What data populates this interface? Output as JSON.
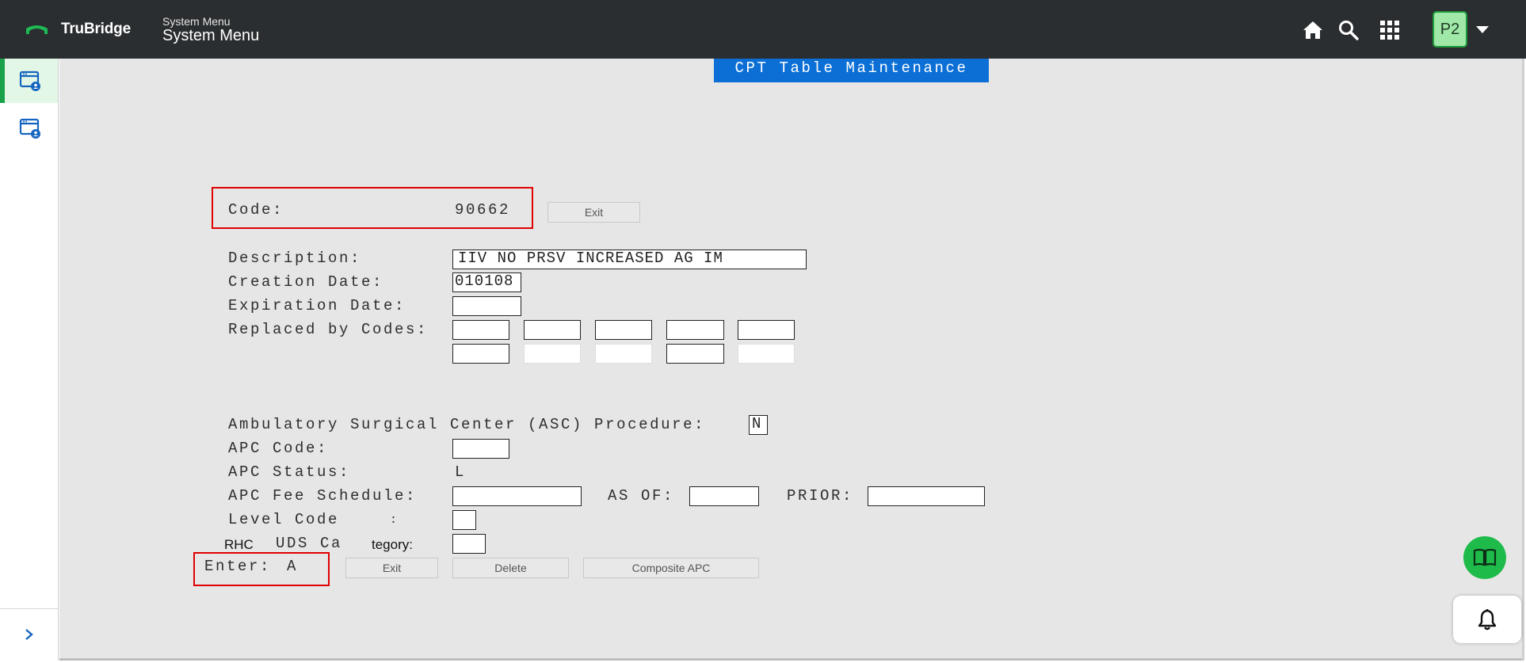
{
  "header": {
    "brand": "TruBridge",
    "menu_sub": "System Menu",
    "menu_title": "System Menu",
    "avatar_initials": "P2",
    "icons": [
      "home-icon",
      "search-icon",
      "apps-grid-icon",
      "chevron-down-icon"
    ]
  },
  "sidebar": {
    "items": [
      {
        "icon": "window-user-icon",
        "active": true
      },
      {
        "icon": "window-user-icon",
        "active": false
      }
    ],
    "expand_icon": "chevron-right-icon"
  },
  "screen": {
    "title": "CPT Table Maintenance",
    "code_label": "Code:",
    "code_value": "90662",
    "exit_top_label": "Exit",
    "description_label": "Description:",
    "description_value": "IIV NO PRSV INCREASED AG IM",
    "creation_date_label": "Creation Date:",
    "creation_date_value": "010108",
    "expiration_date_label": "Expiration Date:",
    "expiration_date_value": "",
    "replaced_by_label": "Replaced by Codes:",
    "asc_label": "Ambulatory Surgical Center (ASC) Procedure:",
    "asc_value": "N",
    "apc_code_label": "APC Code:",
    "apc_code_value": "",
    "apc_status_label": "APC Status:",
    "apc_status_value": "L",
    "apc_fee_label": "APC Fee Schedule:",
    "apc_fee_value": "",
    "as_of_label": "AS OF:",
    "as_of_value": "",
    "prior_label": "PRIOR:",
    "prior_value": "",
    "level_code_label": "Level Code",
    "level_code_colon": ":",
    "level_code_value": "",
    "rhc_label": "RHC",
    "uds_label": "UDS Ca",
    "category_label": "tegory:",
    "uds_value": "",
    "enter_label": "Enter:",
    "enter_value": "A",
    "exit_bottom_label": "Exit",
    "delete_label": "Delete",
    "composite_apc_label": "Composite APC"
  },
  "colors": {
    "topbar": "#2b2e30",
    "accent_green": "#1aa24a",
    "title_blue": "#0b6fd6",
    "highlight_red": "#e00000",
    "screen_bg": "#e6e6e6"
  },
  "floating": {
    "help_icon": "book-open-icon",
    "notifications_icon": "bell-icon"
  }
}
